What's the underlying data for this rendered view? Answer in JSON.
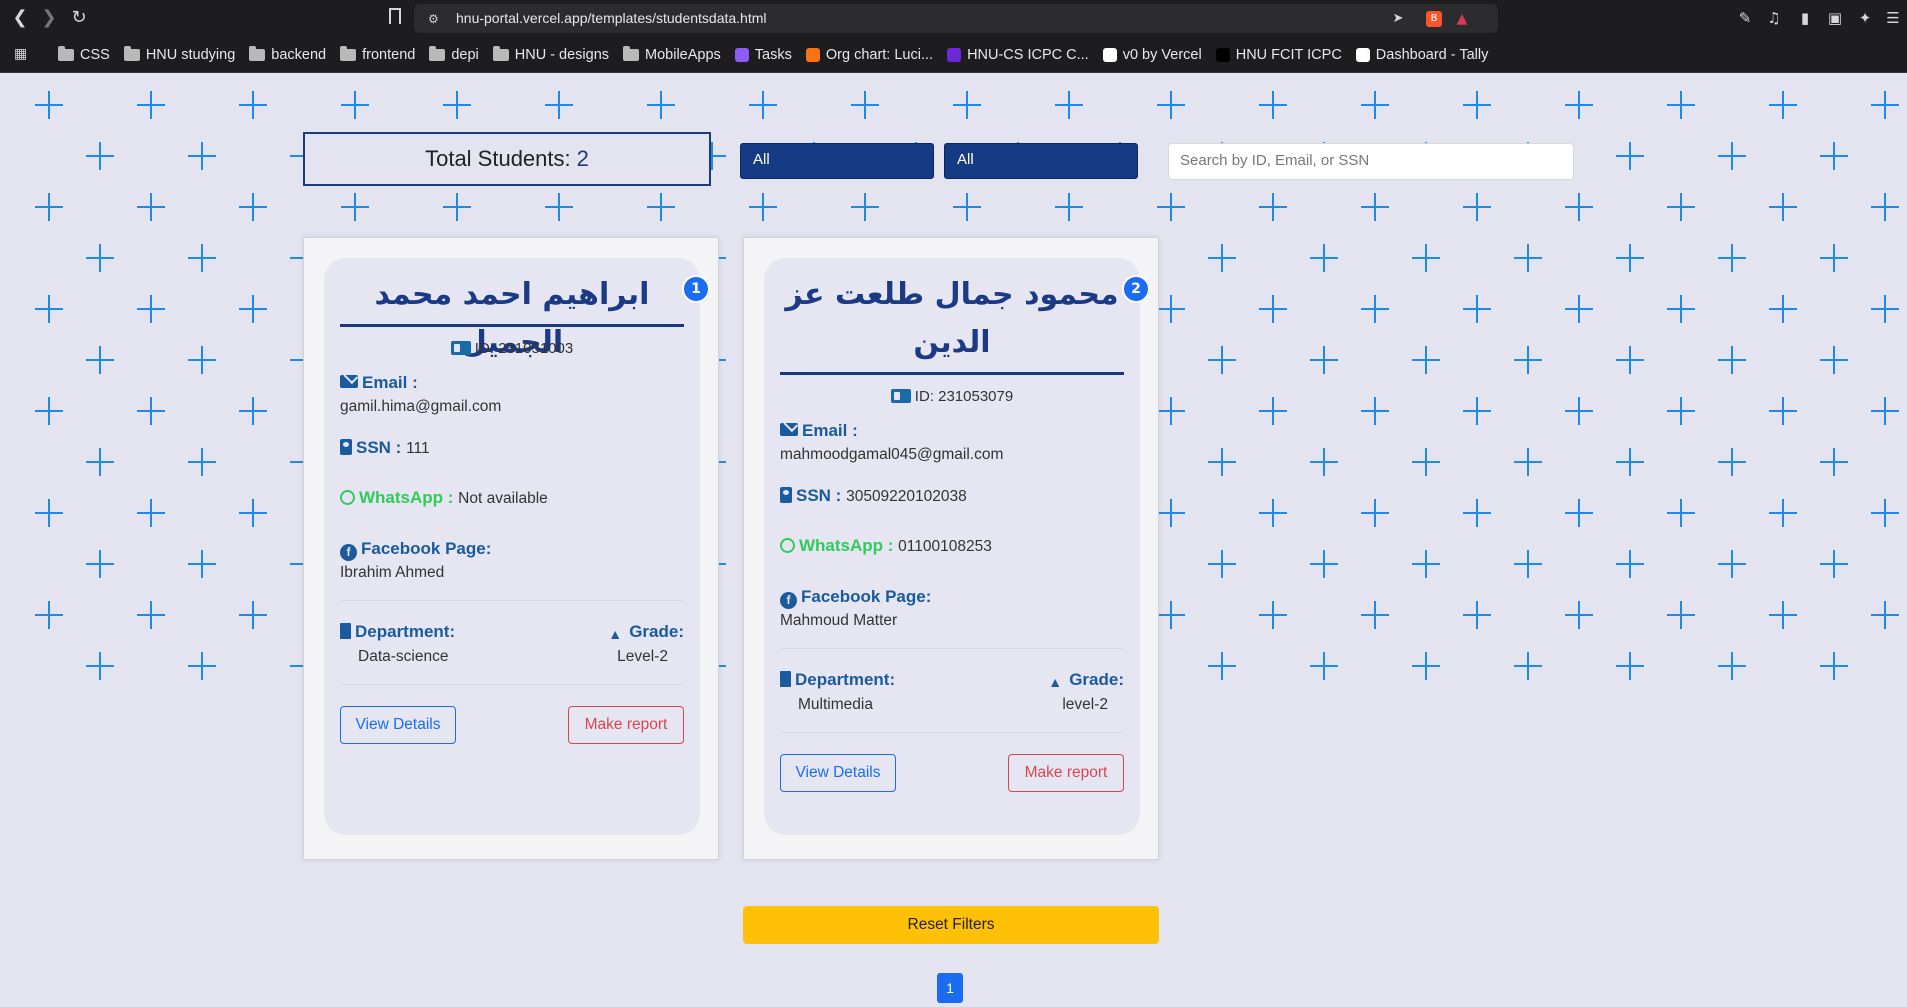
{
  "browser": {
    "url": "hnu-portal.vercel.app/templates/studentsdata.html",
    "bookmarks": [
      {
        "label": "CSS",
        "type": "folder"
      },
      {
        "label": "HNU studying",
        "type": "folder"
      },
      {
        "label": "backend",
        "type": "folder"
      },
      {
        "label": "frontend",
        "type": "folder"
      },
      {
        "label": "depi",
        "type": "folder"
      },
      {
        "label": "HNU - designs",
        "type": "folder"
      },
      {
        "label": "MobileApps",
        "type": "folder"
      },
      {
        "label": "Tasks",
        "type": "link",
        "icon": "tasks-icon",
        "color": "#8b5cf6"
      },
      {
        "label": "Org chart: Luci...",
        "type": "link",
        "icon": "lucid-icon",
        "color": "#f97316"
      },
      {
        "label": "HNU-CS ICPC C...",
        "type": "link",
        "icon": "list-icon",
        "color": "#6d28d9"
      },
      {
        "label": "v0 by Vercel",
        "type": "link",
        "icon": "v0-icon",
        "color": "#ffffff"
      },
      {
        "label": "HNU FCIT ICPC",
        "type": "link",
        "icon": "triangle-icon",
        "color": "#000000"
      },
      {
        "label": "Dashboard - Tally",
        "type": "link",
        "icon": "asterisk-icon",
        "color": "#ffffff"
      }
    ]
  },
  "header": {
    "total_label": "Total Students:",
    "total_count": "2",
    "filter_department": "All",
    "filter_grade": "All",
    "search_placeholder": "Search by ID, Email, or SSN"
  },
  "labels": {
    "email": "Email :",
    "ssn": "SSN :",
    "whatsapp": "WhatsApp :",
    "facebook": "Facebook Page:",
    "department": "Department:",
    "grade": "Grade:",
    "view": "View Details",
    "report": "Make report"
  },
  "students": [
    {
      "index": "1",
      "name": "ابراهيم احمد محمد الجميل",
      "id": "ID: 231051003",
      "email": "gamil.hima@gmail.com",
      "ssn": "111",
      "whatsapp": "Not available",
      "facebook": "Ibrahim Ahmed",
      "department": "Data-science",
      "grade": "Level-2"
    },
    {
      "index": "2",
      "name": "محمود جمال طلعت عز الدين",
      "id": "ID: 231053079",
      "email": "mahmoodgamal045@gmail.com",
      "ssn": "30509220102038",
      "whatsapp": "01100108253",
      "facebook": "Mahmoud Matter",
      "department": "Multimedia",
      "grade": "level-2"
    }
  ],
  "footer": {
    "reset_label": "Reset Filters",
    "page_number": "1"
  }
}
